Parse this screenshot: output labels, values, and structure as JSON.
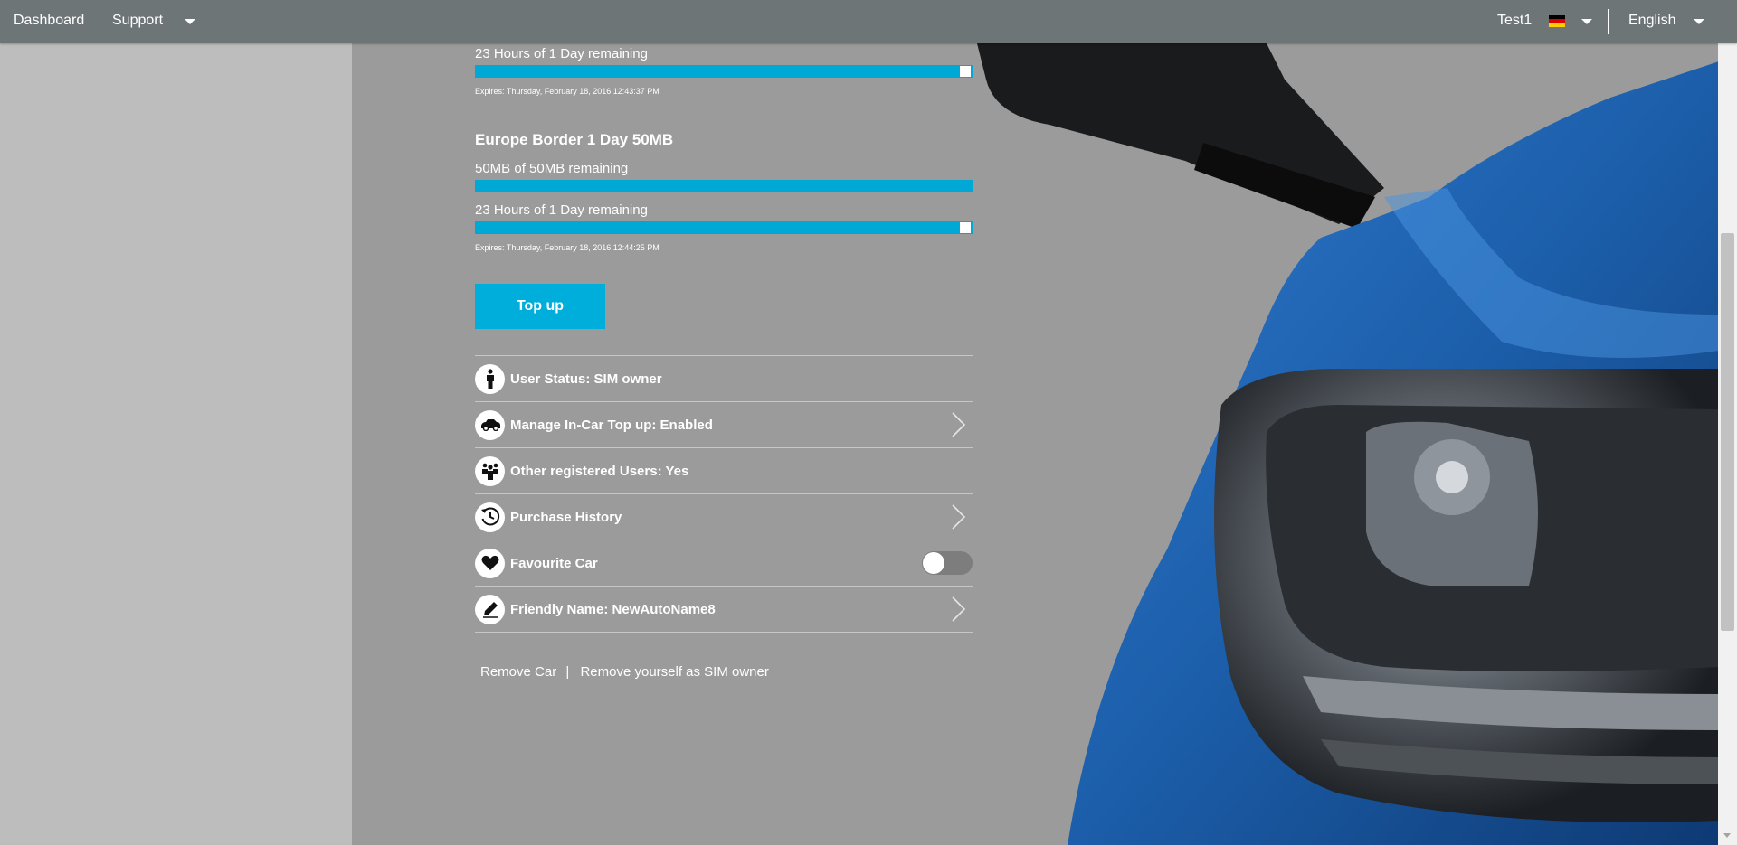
{
  "nav": {
    "dashboard": "Dashboard",
    "support": "Support",
    "user": "Test1",
    "language": "English"
  },
  "plan1": {
    "time_remaining": "23 Hours of 1 Day remaining",
    "time_fraction": 0.97,
    "expires": "Expires: Thursday, February 18, 2016 12:43:37 PM"
  },
  "plan2": {
    "title": "Europe Border 1 Day 50MB",
    "data_remaining": "50MB of 50MB remaining",
    "data_fraction": 1.0,
    "time_remaining": "23 Hours of 1 Day remaining",
    "time_fraction": 0.97,
    "expires": "Expires: Thursday, February 18, 2016 12:44:25 PM"
  },
  "topup_label": "Top up",
  "menu": {
    "user_status": "User Status: SIM owner",
    "in_car_topup": "Manage In-Car Top up: Enabled",
    "other_users": "Other registered Users: Yes",
    "purchase_history": "Purchase History",
    "favourite_car": "Favourite Car",
    "favourite_car_on": false,
    "friendly_name": "Friendly Name: NewAutoName8"
  },
  "footer": {
    "remove_car": "Remove Car",
    "separator": "|",
    "remove_owner": "Remove yourself as SIM owner"
  },
  "colors": {
    "accent": "#00aedb",
    "topbar": "#6e7577",
    "background": "#9b9b9b",
    "car_blue": "#1f5fa8"
  },
  "icons": [
    "person-icon",
    "car-icon",
    "users-icon",
    "history-icon",
    "heart-icon",
    "pencil-icon",
    "chevron-right-icon",
    "caret-down-icon",
    "german-flag-icon"
  ]
}
